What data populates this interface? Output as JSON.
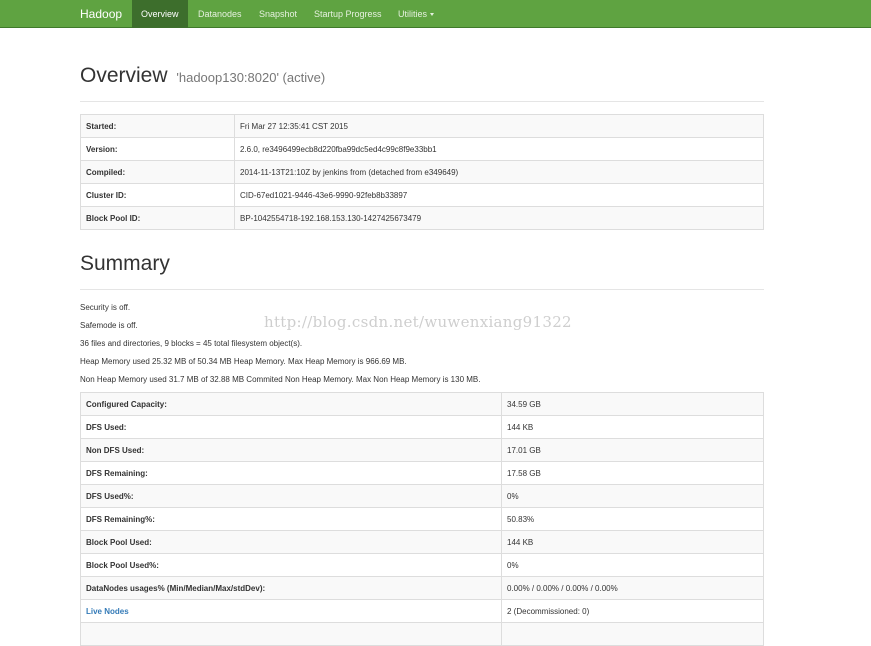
{
  "navbar": {
    "brand": "Hadoop",
    "items": [
      {
        "label": "Overview"
      },
      {
        "label": "Datanodes"
      },
      {
        "label": "Snapshot"
      },
      {
        "label": "Startup Progress"
      },
      {
        "label": "Utilities"
      }
    ]
  },
  "overview": {
    "title": "Overview",
    "subtitle": "'hadoop130:8020' (active)",
    "rows": [
      {
        "key": "Started:",
        "value": "Fri Mar 27 12:35:41 CST 2015"
      },
      {
        "key": "Version:",
        "value": "2.6.0, re3496499ecb8d220fba99dc5ed4c99c8f9e33bb1"
      },
      {
        "key": "Compiled:",
        "value": "2014-11-13T21:10Z by jenkins from (detached from e349649)"
      },
      {
        "key": "Cluster ID:",
        "value": "CID-67ed1021-9446-43e6-9990-92feb8b33897"
      },
      {
        "key": "Block Pool ID:",
        "value": "BP-1042554718-192.168.153.130-1427425673479"
      }
    ]
  },
  "summary": {
    "title": "Summary",
    "lines": [
      "Security is off.",
      "Safemode is off.",
      "36 files and directories, 9 blocks = 45 total filesystem object(s).",
      "Heap Memory used 25.32 MB of 50.34 MB Heap Memory. Max Heap Memory is 966.69 MB.",
      "Non Heap Memory used 31.7 MB of 32.88 MB Commited Non Heap Memory. Max Non Heap Memory is 130 MB."
    ],
    "rows": [
      {
        "key": "Configured Capacity:",
        "value": "34.59 GB"
      },
      {
        "key": "DFS Used:",
        "value": "144 KB"
      },
      {
        "key": "Non DFS Used:",
        "value": "17.01 GB"
      },
      {
        "key": "DFS Remaining:",
        "value": "17.58 GB"
      },
      {
        "key": "DFS Used%:",
        "value": "0%"
      },
      {
        "key": "DFS Remaining%:",
        "value": "50.83%"
      },
      {
        "key": "Block Pool Used:",
        "value": "144 KB"
      },
      {
        "key": "Block Pool Used%:",
        "value": "0%"
      },
      {
        "key": "DataNodes usages% (Min/Median/Max/stdDev):",
        "value": "0.00% / 0.00% / 0.00% / 0.00%"
      },
      {
        "key": "Live Nodes",
        "value": "2 (Decommissioned: 0)"
      }
    ]
  },
  "watermark": "http://blog.csdn.net/wuwenxiang91322",
  "colors": {
    "navbar": "#5fa341",
    "navbar_active": "#3d6e2c",
    "link": "#337ab7"
  }
}
